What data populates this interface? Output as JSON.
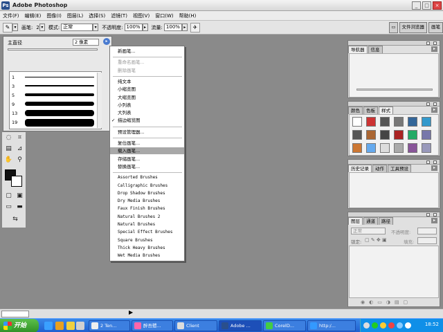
{
  "window": {
    "title": "Adobe Photoshop",
    "controls": [
      "_",
      "□",
      "×"
    ]
  },
  "menubar": [
    "文件(F)",
    "编辑(E)",
    "图像(I)",
    "图层(L)",
    "选择(S)",
    "滤镜(T)",
    "视图(V)",
    "窗口(W)",
    "帮助(H)"
  ],
  "options": {
    "brush_label": "画笔:",
    "brush_size": "2",
    "mode_label": "模式:",
    "mode_value": "正常",
    "opacity_label": "不透明度:",
    "opacity_value": "100%",
    "flow_label": "流量:",
    "flow_value": "100%"
  },
  "palette_well": {
    "tabs": [
      "文件浏览器",
      "画笔"
    ]
  },
  "brush_picker": {
    "master_label": "主直径",
    "master_value": "2 像素",
    "brushes": [
      "1",
      "3",
      "5",
      "9",
      "13",
      "19"
    ]
  },
  "flyout_menu": {
    "items": [
      {
        "label": "新画笔...",
        "disabled": false
      },
      {
        "sep": true
      },
      {
        "label": "重命名画笔...",
        "disabled": true
      },
      {
        "label": "删除画笔",
        "disabled": true
      },
      {
        "sep": true
      },
      {
        "label": "纯文本",
        "disabled": false
      },
      {
        "label": "小缩览图",
        "disabled": false
      },
      {
        "label": "大缩览图",
        "disabled": false
      },
      {
        "label": "小列表",
        "disabled": false
      },
      {
        "label": "大列表",
        "disabled": false
      },
      {
        "label": "描边缩览图",
        "disabled": false,
        "checked": true
      },
      {
        "sep": true
      },
      {
        "label": "预设管理器...",
        "disabled": false
      },
      {
        "sep": true
      },
      {
        "label": "复位画笔...",
        "disabled": false
      },
      {
        "label": "载入画笔...",
        "disabled": false,
        "highlighted": true
      },
      {
        "label": "存储画笔...",
        "disabled": false
      },
      {
        "label": "替换画笔...",
        "disabled": false
      },
      {
        "sep": true
      },
      {
        "label": "Assorted Brushes",
        "mono": true
      },
      {
        "label": "Calligraphic Brushes",
        "mono": true
      },
      {
        "label": "Drop Shadow Brushes",
        "mono": true
      },
      {
        "label": "Dry Media Brushes",
        "mono": true
      },
      {
        "label": "Faux Finish Brushes",
        "mono": true
      },
      {
        "label": "Natural Brushes 2",
        "mono": true
      },
      {
        "label": "Natural Brushes",
        "mono": true
      },
      {
        "label": "Special Effect Brushes",
        "mono": true
      },
      {
        "label": "Square Brushes",
        "mono": true
      },
      {
        "label": "Thick Heavy Brushes",
        "mono": true
      },
      {
        "label": "Wet Media Brushes",
        "mono": true
      }
    ]
  },
  "palettes": {
    "navigator": {
      "tabs": [
        "导航器",
        "信息"
      ]
    },
    "styles": {
      "tabs": [
        "颜色",
        "色板",
        "样式"
      ]
    },
    "history": {
      "tabs": [
        "历史记录",
        "动作",
        "工具预设"
      ]
    },
    "layers": {
      "tabs": [
        "图层",
        "通道",
        "路径"
      ],
      "blend": "正常",
      "opacity_label": "不透明度:",
      "lock_label": "锁定:",
      "fill_label": "填充:"
    }
  },
  "taskbar": {
    "start": "开始",
    "tasks": [
      "2 Ten...",
      "醉吾戆...",
      "Client",
      "Adobe ...",
      "CorelD...",
      "http:/..."
    ],
    "clock": "18:52"
  },
  "colors": {
    "accent": "#316ac5",
    "taskbar": "#2a6fe0",
    "start": "#3a9e30"
  }
}
